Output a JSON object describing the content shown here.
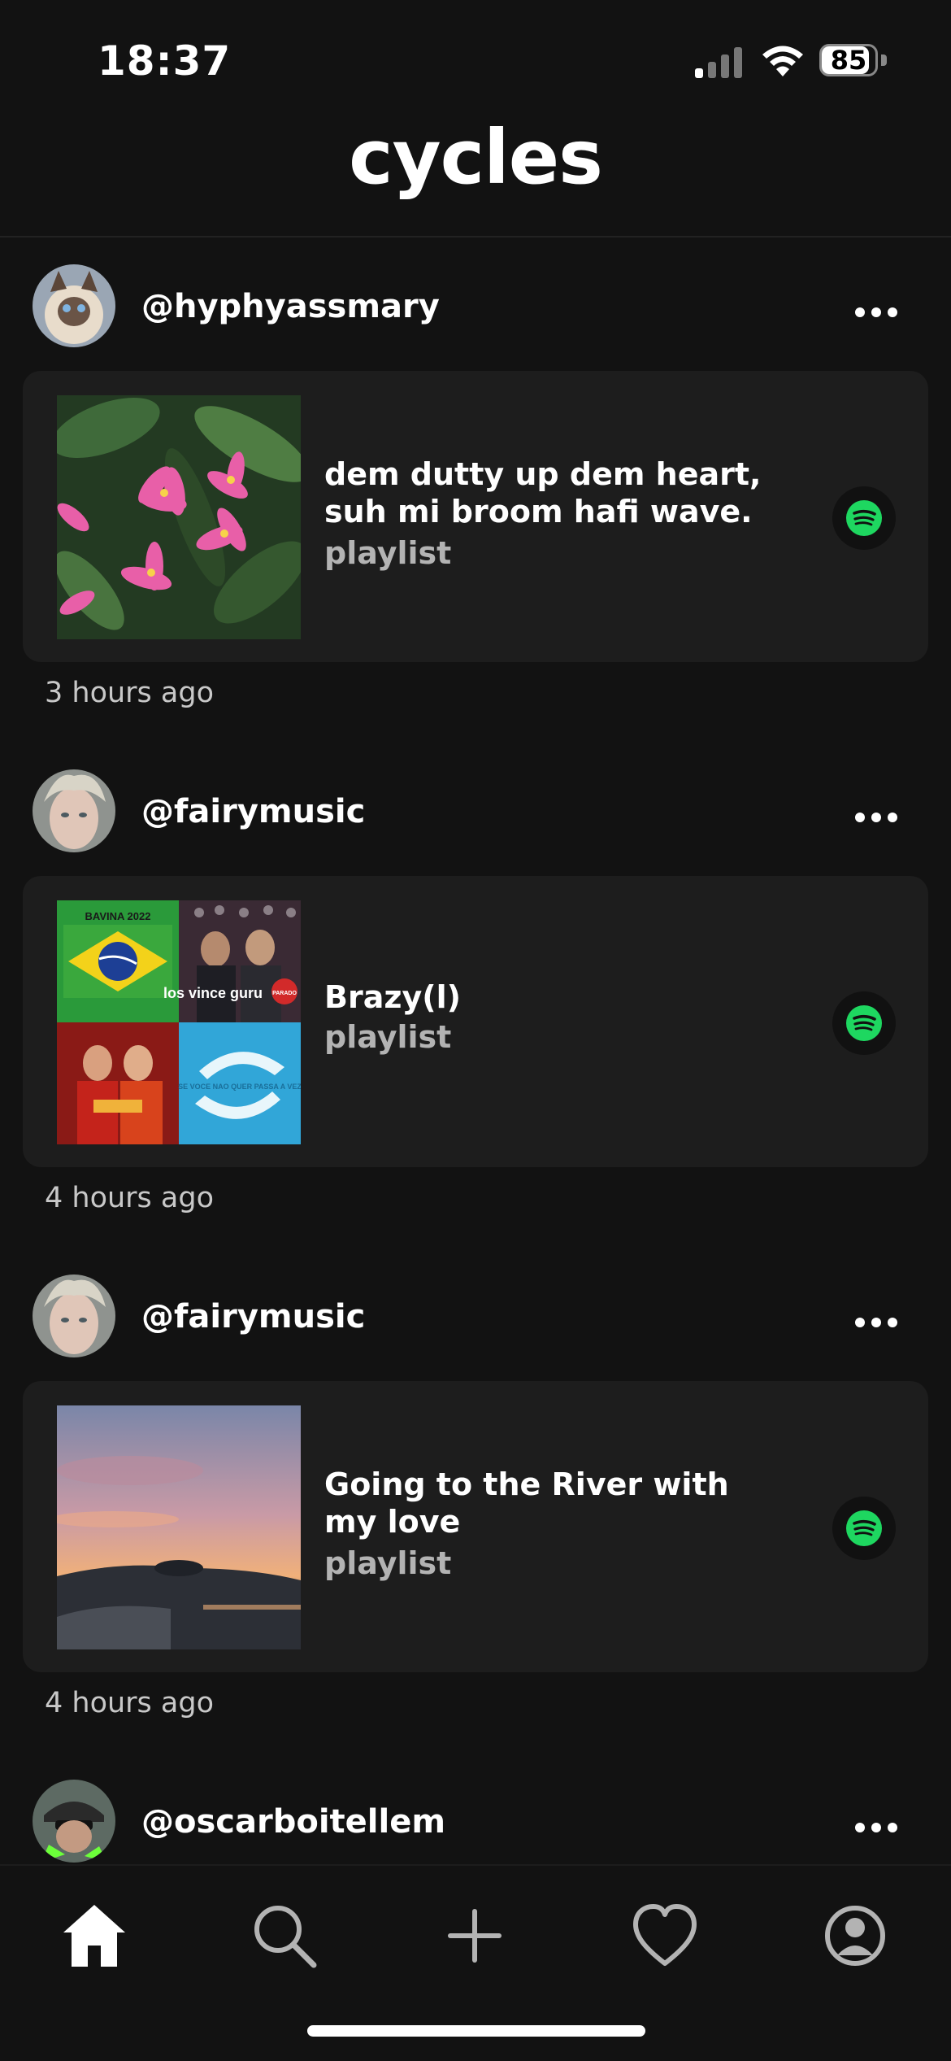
{
  "status_bar": {
    "time": "18:37",
    "battery": "85"
  },
  "header": {
    "title": "cycles"
  },
  "posts": [
    {
      "username": "@hyphyassmary",
      "title": "dem dutty up dem heart, suh mi broom hafi wave.",
      "type": "playlist",
      "time_ago": "3 hours ago",
      "service_icon": "spotify-icon"
    },
    {
      "username": "@fairymusic",
      "title": "Brazy(l)",
      "type": "playlist",
      "time_ago": "4 hours ago",
      "service_icon": "spotify-icon",
      "cover_text": [
        "BAVINA 2022",
        "los vince guru",
        "PARADO",
        "SE VOCE NAO QUER PASSA A VEZ"
      ]
    },
    {
      "username": "@fairymusic",
      "title": "Going to the River with my love",
      "type": "playlist",
      "time_ago": "4 hours ago",
      "service_icon": "spotify-icon"
    },
    {
      "username": "@oscarboitellem"
    }
  ],
  "tab_bar": {
    "items": [
      "home-icon",
      "search-icon",
      "add-icon",
      "heart-icon",
      "profile-icon"
    ],
    "active": "home-icon"
  },
  "colors": {
    "background": "#121212",
    "card": "#1d1d1d",
    "spotify_green": "#1ed760",
    "muted_text": "#b3b3b3"
  }
}
